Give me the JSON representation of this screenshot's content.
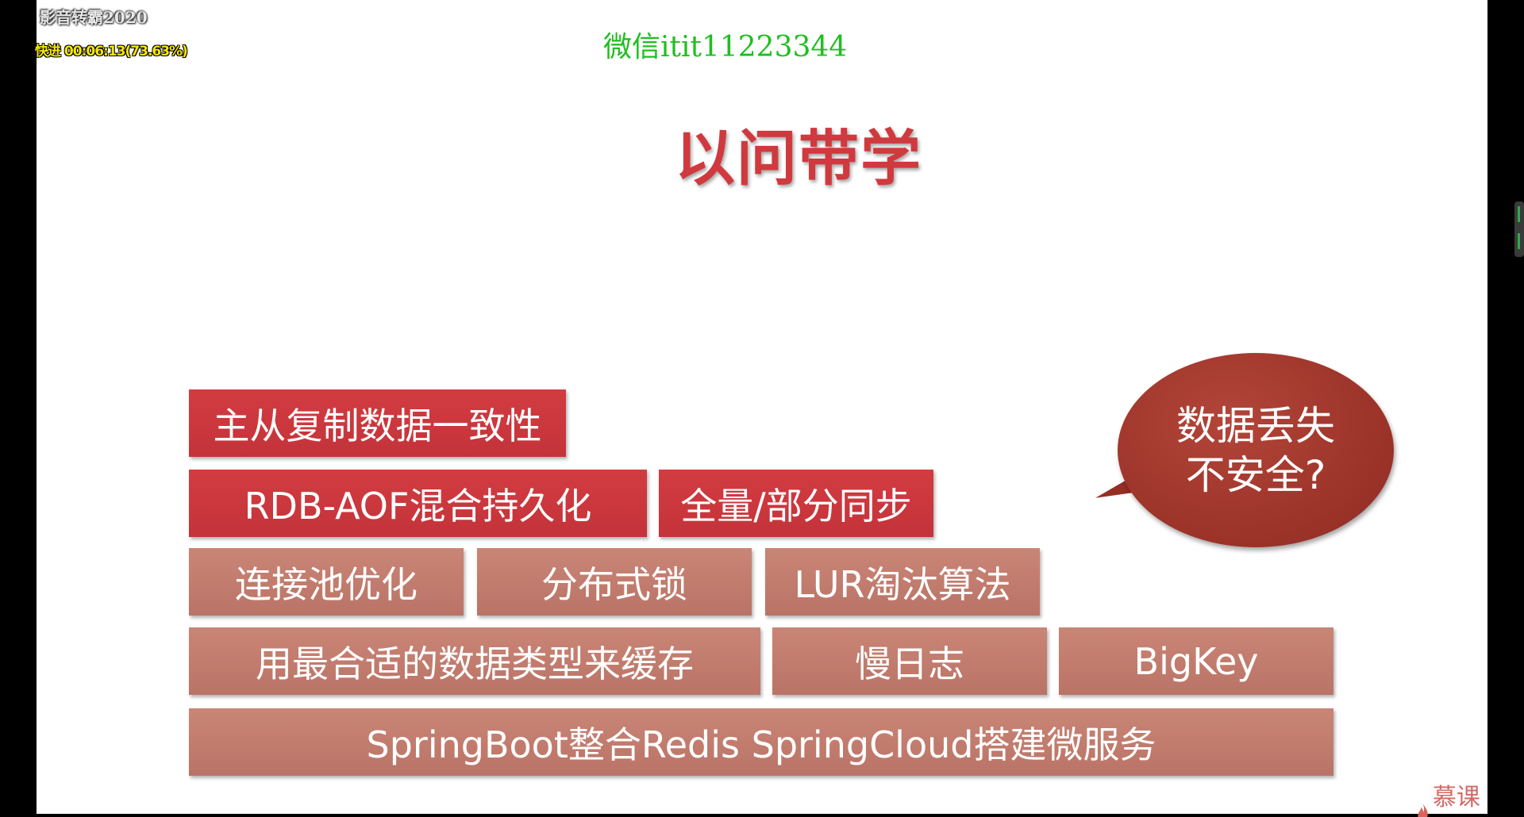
{
  "player": {
    "brand": "影音转霸2020",
    "status": "快进 00:06:13(73.63%)"
  },
  "watermark": {
    "wechat": "微信itit11223344"
  },
  "slide": {
    "title": "以问带学",
    "blocks": {
      "row1": [
        "主从复制数据一致性"
      ],
      "row2": [
        "RDB-AOF混合持久化",
        "全量/部分同步"
      ],
      "row3": [
        "连接池优化",
        "分布式锁",
        "LUR淘汰算法"
      ],
      "row4": [
        "用最合适的数据类型来缓存",
        "慢日志",
        "BigKey"
      ],
      "row5": [
        "SpringBoot整合Redis  SpringCloud搭建微服务"
      ]
    },
    "bubble": {
      "line1": "数据丢失",
      "line2": "不安全?"
    },
    "logo": "慕课网"
  },
  "colors": {
    "title": "#d0393d",
    "block_primary": "#c9383d",
    "block_secondary": "#c07b6d",
    "bubble": "#9e3328",
    "watermark": "#1fbf1f"
  }
}
